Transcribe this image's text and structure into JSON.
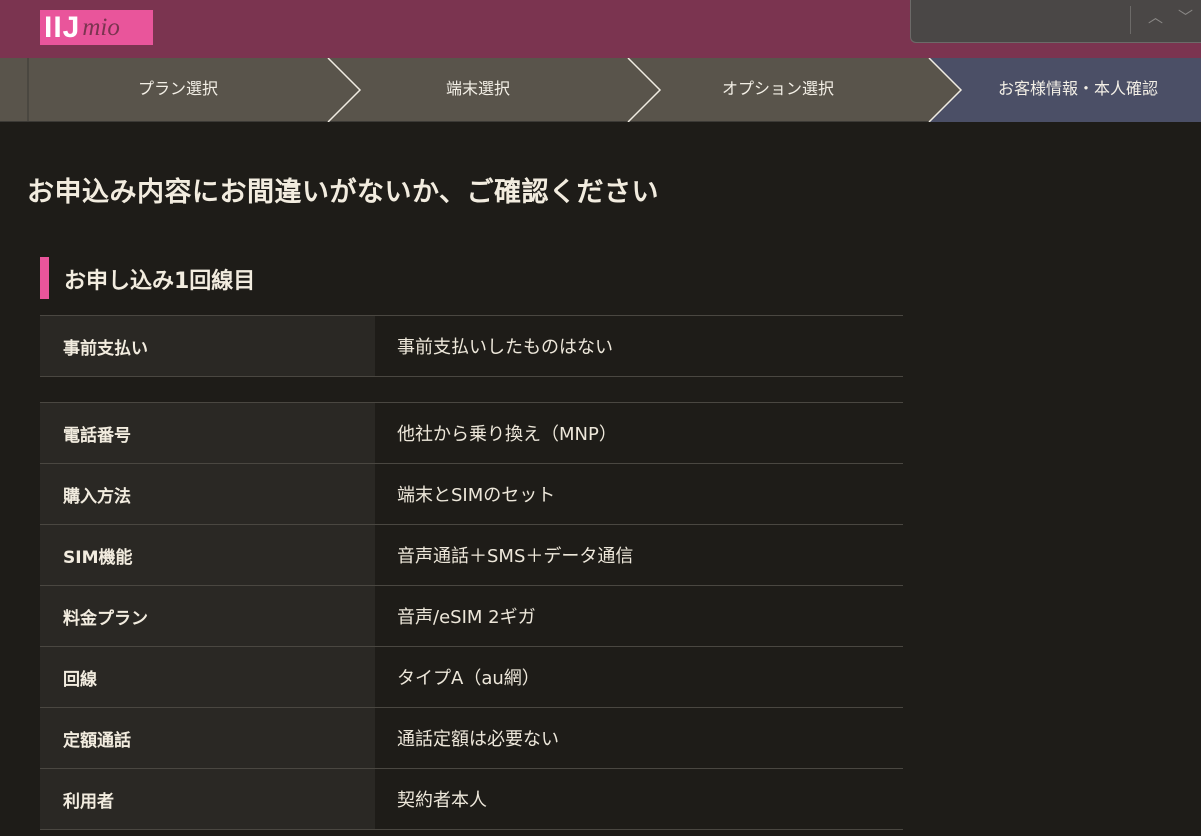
{
  "header": {
    "logo_ij": "IIJ",
    "logo_mio": "mio"
  },
  "steps": [
    {
      "label": "プラン選択",
      "active": false
    },
    {
      "label": "端末選択",
      "active": false
    },
    {
      "label": "オプション選択",
      "active": false
    },
    {
      "label": "お客様情報・本人確認",
      "active": true
    }
  ],
  "page_title": "お申込み内容にお間違いがないか、ご確認ください",
  "section": {
    "title": "お申し込み1回線目"
  },
  "prepay": {
    "label": "事前支払い",
    "value": "事前支払いしたものはない"
  },
  "details": [
    {
      "label": "電話番号",
      "value": "他社から乗り換え（MNP）"
    },
    {
      "label": "購入方法",
      "value": "端末とSIMのセット"
    },
    {
      "label": "SIM機能",
      "value": "音声通話＋SMS＋データ通信"
    },
    {
      "label": "料金プラン",
      "value": "音声/eSIM 2ギガ"
    },
    {
      "label": "回線",
      "value": "タイプA（au網）"
    },
    {
      "label": "定額通話",
      "value": "通話定額は必要ない"
    },
    {
      "label": "利用者",
      "value": "契約者本人"
    }
  ],
  "colors": {
    "header_bg": "#7b3450",
    "accent_pink": "#e9559b",
    "steps_bg": "#59544b",
    "active_step_bg": "#4b4f66",
    "page_bg": "#1e1c18"
  }
}
